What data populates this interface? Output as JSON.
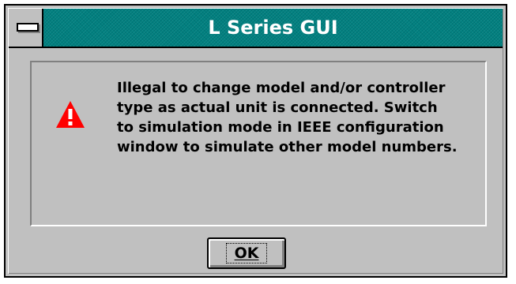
{
  "window": {
    "title": "L Series GUI"
  },
  "dialog": {
    "icon": "warning-icon",
    "message_lines": [
      "Illegal to change model and/or controller",
      "type as actual unit is connected. Switch",
      "to simulation mode in IEEE configuration",
      "window to simulate other model numbers."
    ],
    "ok_label": "OK"
  },
  "colors": {
    "titlebar": "#008080",
    "title_text": "#ffffff",
    "face": "#c0c0c0",
    "warning_red": "#ff0000"
  }
}
